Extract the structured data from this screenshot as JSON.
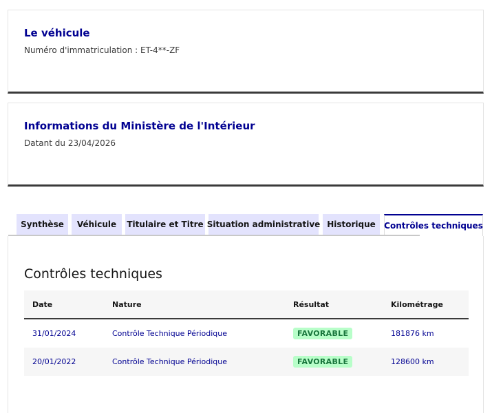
{
  "vehicle_card": {
    "title": "Le véhicule",
    "registration": "Numéro d'immatriculation : ET-4**-ZF"
  },
  "ministry_card": {
    "title": "Informations du Ministère de l'Intérieur",
    "date": "Datant du 23/04/2026"
  },
  "tabs": [
    {
      "label": "Synthèse",
      "active": false
    },
    {
      "label": "Véhicule",
      "active": false
    },
    {
      "label": "Titulaire et Titre",
      "active": false
    },
    {
      "label": "Situation administrative",
      "active": false
    },
    {
      "label": "Historique",
      "active": false
    },
    {
      "label": "Contrôles techniques",
      "active": true
    }
  ],
  "panel": {
    "title": "Contrôles techniques",
    "columns": [
      "Date",
      "Nature",
      "Résultat",
      "Kilométrage"
    ],
    "rows": [
      {
        "date": "31/01/2024",
        "nature": "Contrôle Technique Périodique",
        "result": "FAVORABLE",
        "mileage": "181876 km"
      },
      {
        "date": "20/01/2022",
        "nature": "Contrôle Technique Périodique",
        "result": "FAVORABLE",
        "mileage": "128600 km"
      }
    ]
  },
  "colors": {
    "primary": "#000091",
    "tab_bg": "#e3e3fd",
    "badge_bg": "#b8fec9",
    "badge_text": "#18753c"
  }
}
